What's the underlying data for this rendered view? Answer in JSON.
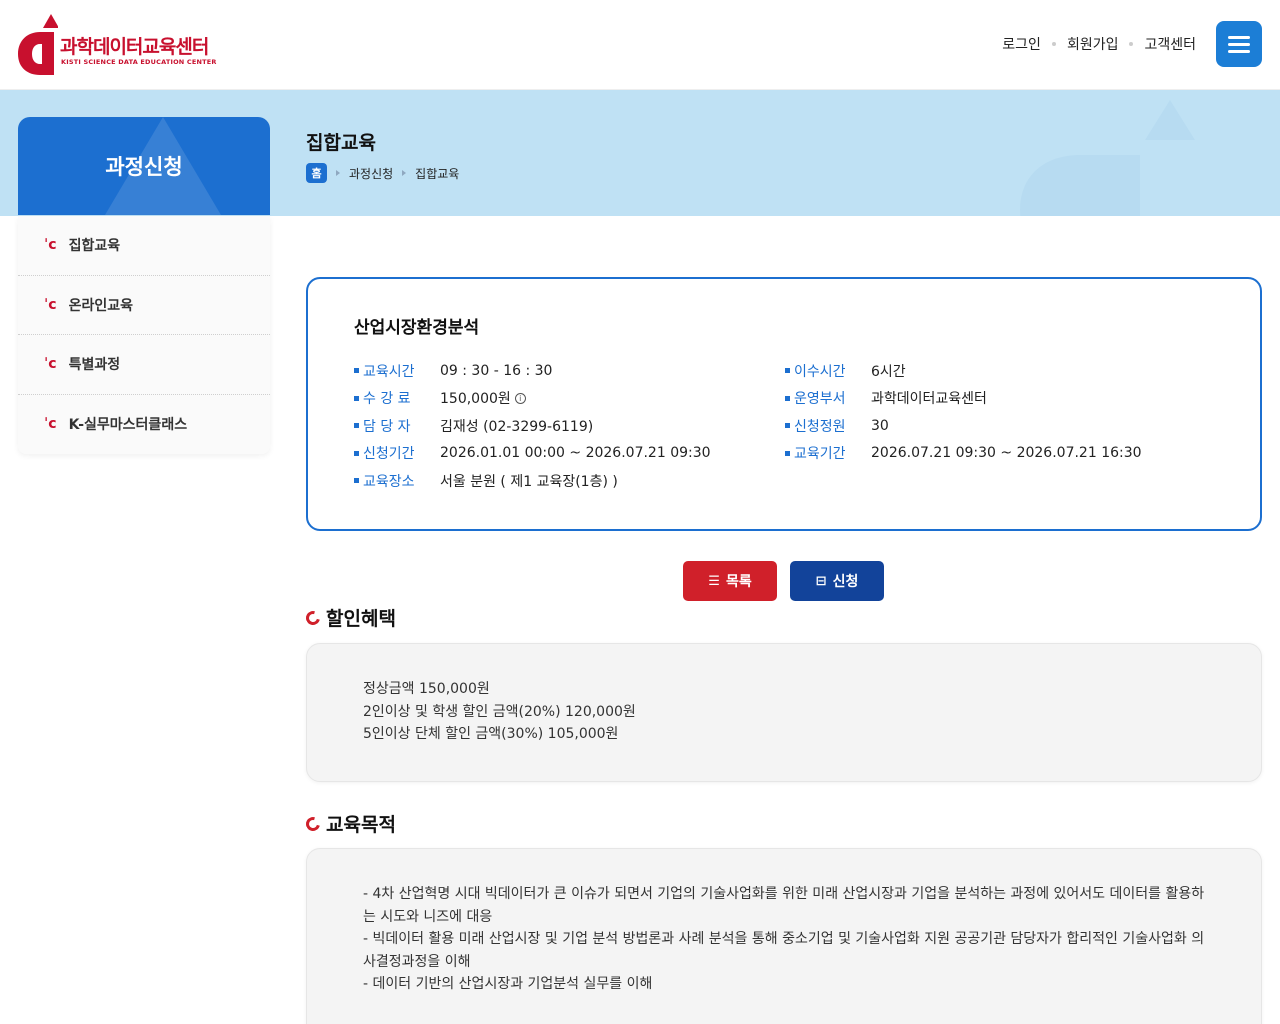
{
  "header": {
    "logo_text": "과학데이터교육센터",
    "logo_sub": "KISTI SCIENCE DATA EDUCATION CENTER",
    "nav": [
      "로그인",
      "회원가입",
      "고객센터"
    ]
  },
  "sidebar": {
    "title": "과정신청",
    "items": [
      {
        "label": "집합교육"
      },
      {
        "label": "온라인교육"
      },
      {
        "label": "특별과정"
      },
      {
        "label": "K-실무마스터클래스"
      }
    ]
  },
  "page": {
    "title": "집합교육",
    "breadcrumb": [
      "홈",
      "과정신청",
      "집합교육"
    ]
  },
  "course": {
    "title": "산업시장환경분석",
    "left": [
      {
        "label": "교육시간",
        "value": "09 : 30 - 16 : 30"
      },
      {
        "label": "수 강 료",
        "value": "150,000원"
      },
      {
        "label": "담 당 자",
        "value": "김재성 (02-3299-6119)"
      },
      {
        "label": "신청기간",
        "value": "2026.01.01 00:00 ~ 2026.07.21 09:30"
      },
      {
        "label": "교육장소",
        "value": "서울 분원 ( 제1 교육장(1층) )"
      }
    ],
    "right": [
      {
        "label": "이수시간",
        "value": "6시간"
      },
      {
        "label": "운영부서",
        "value": "과학데이터교육센터"
      },
      {
        "label": "신청정원",
        "value": "30"
      },
      {
        "label": "교육기간",
        "value": "2026.07.21 09:30 ~ 2026.07.21 16:30"
      }
    ]
  },
  "buttons": {
    "list": "목록",
    "apply": "신청"
  },
  "benefit": {
    "title": "할인혜택",
    "lines": [
      "정상금액 150,000원",
      "2인이상 및 학생 할인 금액(20%) 120,000원",
      "5인이상 단체 할인 금액(30%) 105,000원"
    ]
  },
  "purpose": {
    "title": "교육목적",
    "lines": [
      "- 4차 산업혁명 시대 빅데이터가 큰 이슈가 되면서 기업의 기술사업화를 위한 미래 산업시장과 기업을 분석하는 과정에 있어서도 데이터를 활용하는 시도와 니즈에 대응",
      "- 빅데이터 활용 미래 산업시장 및 기업 분석 방법론과 사례 분석을 통해 중소기업 및 기술사업화 지원 공공기관 담당자가 합리적인 기술사업화 의사결정과정을 이해",
      "- 데이터 기반의 산업시장과 기업분석 실무를 이해"
    ]
  },
  "colors": {
    "brand_red": "#c8102e",
    "primary_blue": "#1c6fd0",
    "dark_blue": "#12439a",
    "banner_bg": "#bfe1f4"
  }
}
